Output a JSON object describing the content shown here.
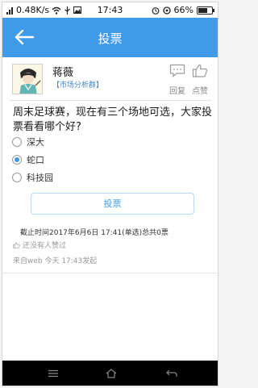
{
  "status_bar": {
    "network": "0.48K/s",
    "time": "17:43",
    "battery": "66%",
    "battery_level": 0.66
  },
  "nav": {
    "title": "投票",
    "back_icon": "back-arrow-icon"
  },
  "post": {
    "author": "蒋薇",
    "group": "【市场分析群】",
    "actions": {
      "reply": "回复",
      "like": "点赞"
    },
    "question": "周末足球赛，现在有三个场地可选，大家投票看看哪个好?",
    "options": [
      {
        "label": "深大",
        "selected": false
      },
      {
        "label": "蛇口",
        "selected": true
      },
      {
        "label": "科技园",
        "selected": false
      }
    ],
    "vote_button": "投票",
    "deadline": "截止时间2017年6月6日 17:41(单选)总共0票",
    "likes_text": "还没有人赞过",
    "source": "来自web  今天 17:43发起"
  },
  "colors": {
    "accent": "#3f9bea",
    "group_link": "#3e86d2"
  }
}
